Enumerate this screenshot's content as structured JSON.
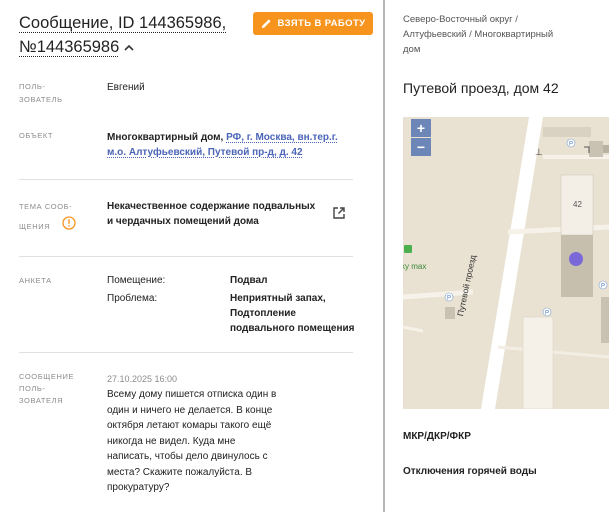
{
  "message": {
    "title": "Сообщение, ID 144365986, №144365986",
    "take_button": "ВЗЯТЬ В РАБОТУ"
  },
  "fields": {
    "user_label_1": "ПОЛЬ-",
    "user_label_2": "ЗОВАТЕЛЬ",
    "user_value": "Евгений",
    "object_label": "ОБЪЕКТ",
    "object_prefix": "Многоквартирный дом,",
    "object_link_1": "РФ, г. Москва, вн.тер.г.",
    "object_link_2": "м.о. Алтуфьевский, Путевой пр-д, д. 42",
    "topic_label_1": "ТЕМА СООБ-",
    "topic_label_2": "ЩЕНИЯ",
    "topic_value_1": "Некачественное содержание подвальных",
    "topic_value_2": "и чердачных помещений дома",
    "form_label": "АНКЕТА",
    "form_rows": [
      {
        "key": "Помещение:",
        "value_lines": [
          "Подвал"
        ]
      },
      {
        "key": "Проблема:",
        "value_lines": [
          "Неприятный запах,",
          "Подтопление",
          "подвального помещения"
        ]
      }
    ],
    "user_msg_label_1": "СООБЩЕНИЕ",
    "user_msg_label_2": "ПОЛЬ-",
    "user_msg_label_3": "ЗОВАТЕЛЯ",
    "user_msg_date": "27.10.2025 16:00",
    "user_msg_lines": [
      "Всему дому пишется отписка один в",
      "один и ничего не делается. В конце",
      "октября летают комары такого ещё",
      "никогда не видел. Куда мне",
      "написать, чтобы дело двинулось с",
      "места? Скажите пожалуйста. В",
      "прокуратуру?"
    ]
  },
  "right": {
    "breadcrumb_1": "Северо-Восточный округ /",
    "breadcrumb_2": "Алтуфьевский / Многоквартирный",
    "breadcrumb_3": "дом",
    "address": "Путевой проезд, дом 42",
    "map": {
      "zoom_in": "+",
      "zoom_out": "−",
      "building_number": "42",
      "street_name": "Путевой проезд",
      "poi_name": "ky max",
      "marker_color": "#7b68d8"
    },
    "section_1": "МКР/ДКР/ФКР",
    "section_2": "Отключения горячей воды"
  },
  "colors": {
    "accent": "#f7941e",
    "link": "#4a64b8",
    "warning": "#f7941e"
  }
}
